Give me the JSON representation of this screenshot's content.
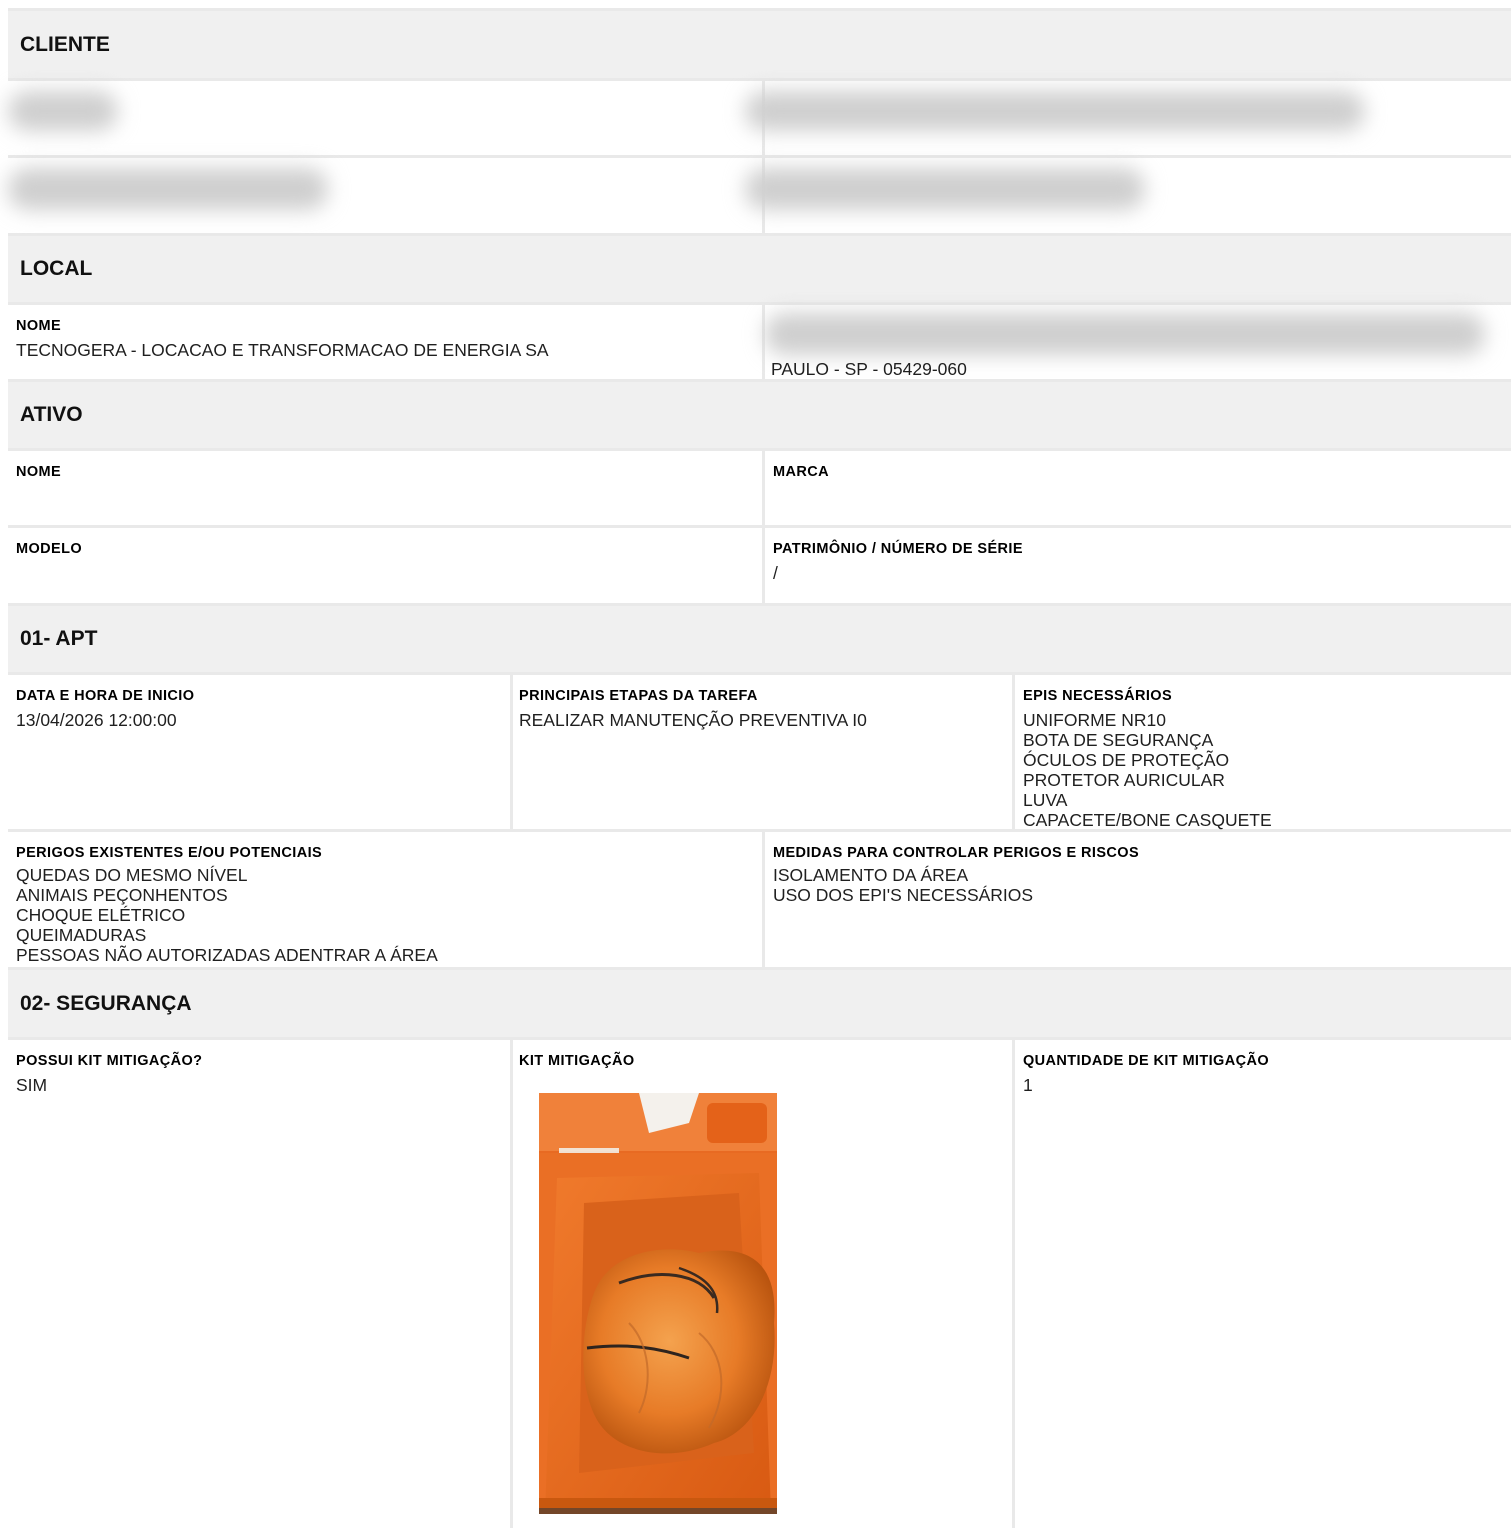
{
  "sections": {
    "cliente": "CLIENTE",
    "local": "LOCAL",
    "ativo": "ATIVO",
    "apt": "01- APT",
    "seguranca": "02- SEGURANÇA"
  },
  "local": {
    "nome_label": "NOME",
    "nome_value": "TECNOGERA - LOCACAO E TRANSFORMACAO DE ENERGIA SA",
    "endereco_tail": "PAULO - SP - 05429-060"
  },
  "ativo": {
    "nome_label": "NOME",
    "marca_label": "MARCA",
    "modelo_label": "MODELO",
    "patrimonio_label": "PATRIMÔNIO / NÚMERO DE SÉRIE",
    "patrimonio_value": "/"
  },
  "apt": {
    "data_label": "DATA E HORA DE INICIO",
    "data_value": "13/04/2026 12:00:00",
    "etapas_label": "PRINCIPAIS ETAPAS DA TAREFA",
    "etapas_value": "REALIZAR MANUTENÇÃO PREVENTIVA I0",
    "epis_label": "EPIS NECESSÁRIOS",
    "epis": [
      "UNIFORME NR10",
      "BOTA DE SEGURANÇA",
      "ÓCULOS DE PROTEÇÃO",
      "PROTETOR AURICULAR",
      "LUVA",
      "CAPACETE/BONE CASQUETE"
    ],
    "perigos_label": "PERIGOS EXISTENTES E/OU POTENCIAIS",
    "perigos": [
      "QUEDAS DO MESMO NÍVEL",
      "ANIMAIS PEÇONHENTOS",
      "CHOQUE ELÉTRICO",
      "QUEIMADURAS",
      "PESSOAS NÃO AUTORIZADAS ADENTRAR A ÁREA"
    ],
    "medidas_label": "MEDIDAS PARA CONTROLAR PERIGOS E RISCOS",
    "medidas": [
      "ISOLAMENTO DA ÁREA",
      "USO DOS EPI'S NECESSÁRIOS"
    ]
  },
  "seguranca": {
    "possui_label": "POSSUI KIT MITIGAÇÃO?",
    "possui_value": "SIM",
    "kit_label": "KIT MITIGAÇÃO",
    "quantidade_label": "QUANTIDADE DE KIT MITIGAÇÃO",
    "quantidade_value": "1"
  },
  "colors": {
    "header_bg": "#f0f0f0",
    "border": "#e9e9e9",
    "bin_orange": "#e8661f"
  }
}
